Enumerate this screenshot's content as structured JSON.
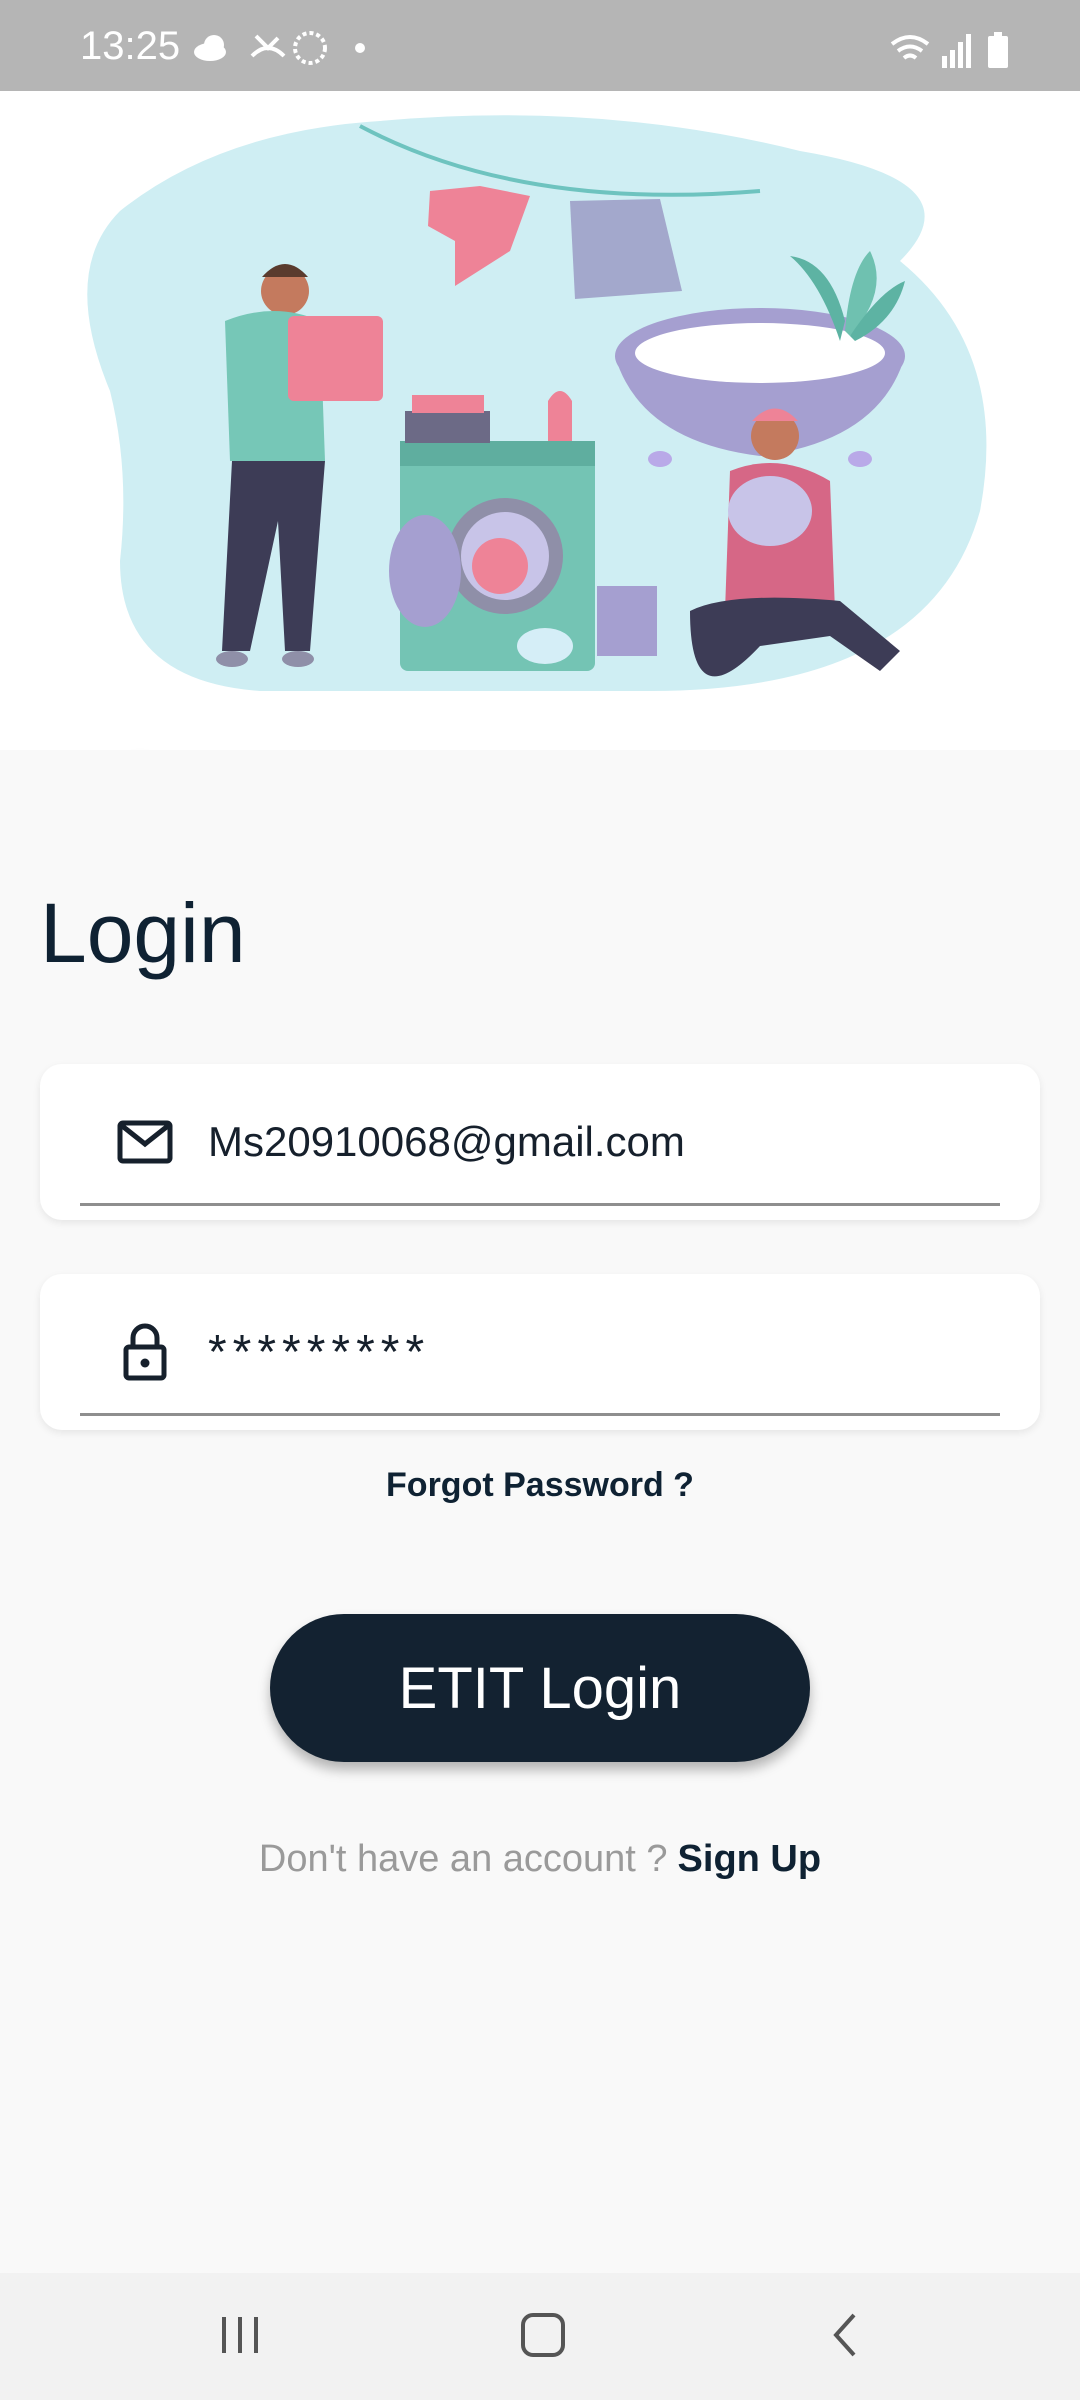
{
  "status_bar": {
    "time": "13:25",
    "icons_left": [
      "cloud-icon",
      "missed-call-icon",
      "sync-icon",
      "dot-icon"
    ],
    "icons_right": [
      "wifi-icon",
      "signal-icon",
      "battery-icon"
    ]
  },
  "hero": {
    "illustration": "laundry-illustration",
    "theme_toggle_icon": "contrast-icon"
  },
  "login": {
    "title": "Login",
    "email": {
      "icon": "mail-icon",
      "value": "Ms20910068@gmail.com"
    },
    "password": {
      "icon": "lock-icon",
      "value": "*********"
    },
    "forgot_password": "Forgot Password ?",
    "login_button": "ETIT Login",
    "signup_prompt": "Don't have an account ?",
    "signup_link": "Sign Up"
  },
  "nav_bar": {
    "buttons": [
      "recent-apps-icon",
      "home-icon",
      "back-icon"
    ]
  },
  "colors": {
    "primary": "#132231",
    "background": "#f9f9f9",
    "status_bar": "#b5b5b5",
    "hero_blob": "#cfeef3"
  }
}
